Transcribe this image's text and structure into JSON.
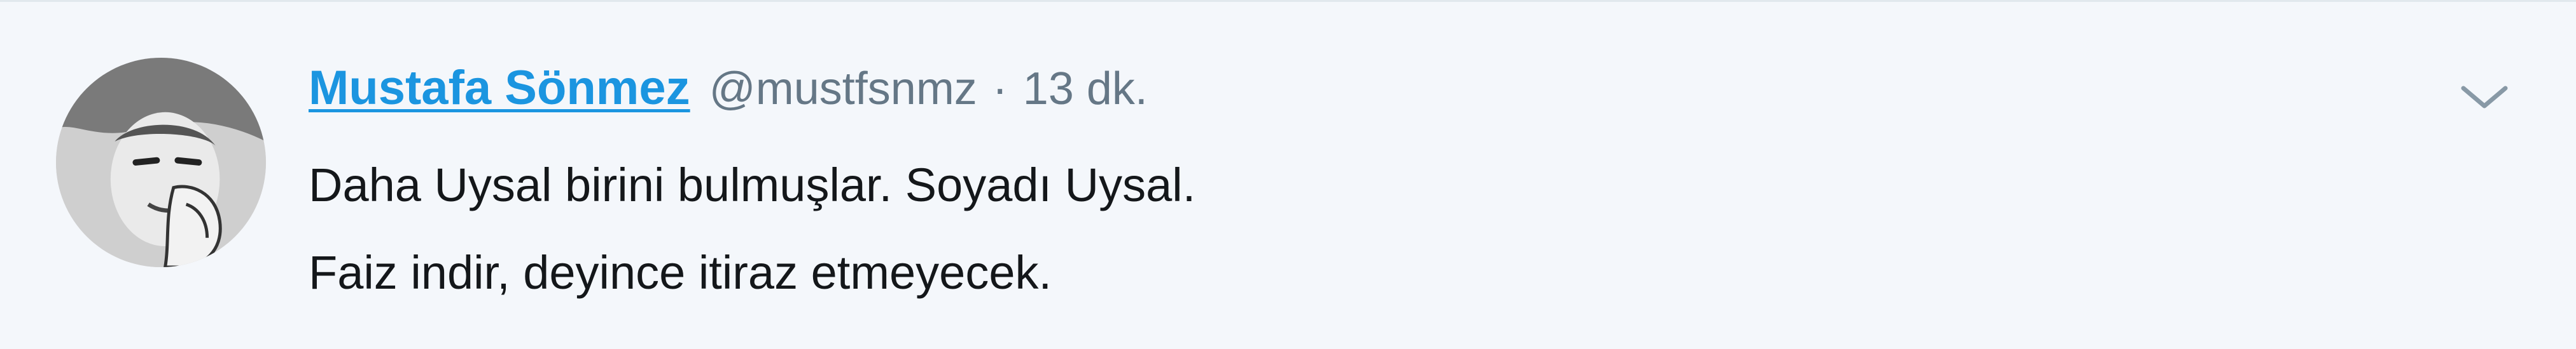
{
  "tweet": {
    "author": {
      "display_name": "Mustafa Sönmez",
      "handle": "@mustfsnmz"
    },
    "separator": "·",
    "timestamp": "13 dk.",
    "text_lines": [
      "Daha Uysal birini bulmuşlar. Soyadı Uysal.",
      "Faiz indir, deyince itiraz etmeyecek."
    ],
    "icons": {
      "menu": "chevron-down-icon",
      "avatar": "profile-photo"
    },
    "colors": {
      "background": "#f4f7fb",
      "name": "#1b95e0",
      "secondary": "#657786",
      "text": "#14171a"
    }
  }
}
